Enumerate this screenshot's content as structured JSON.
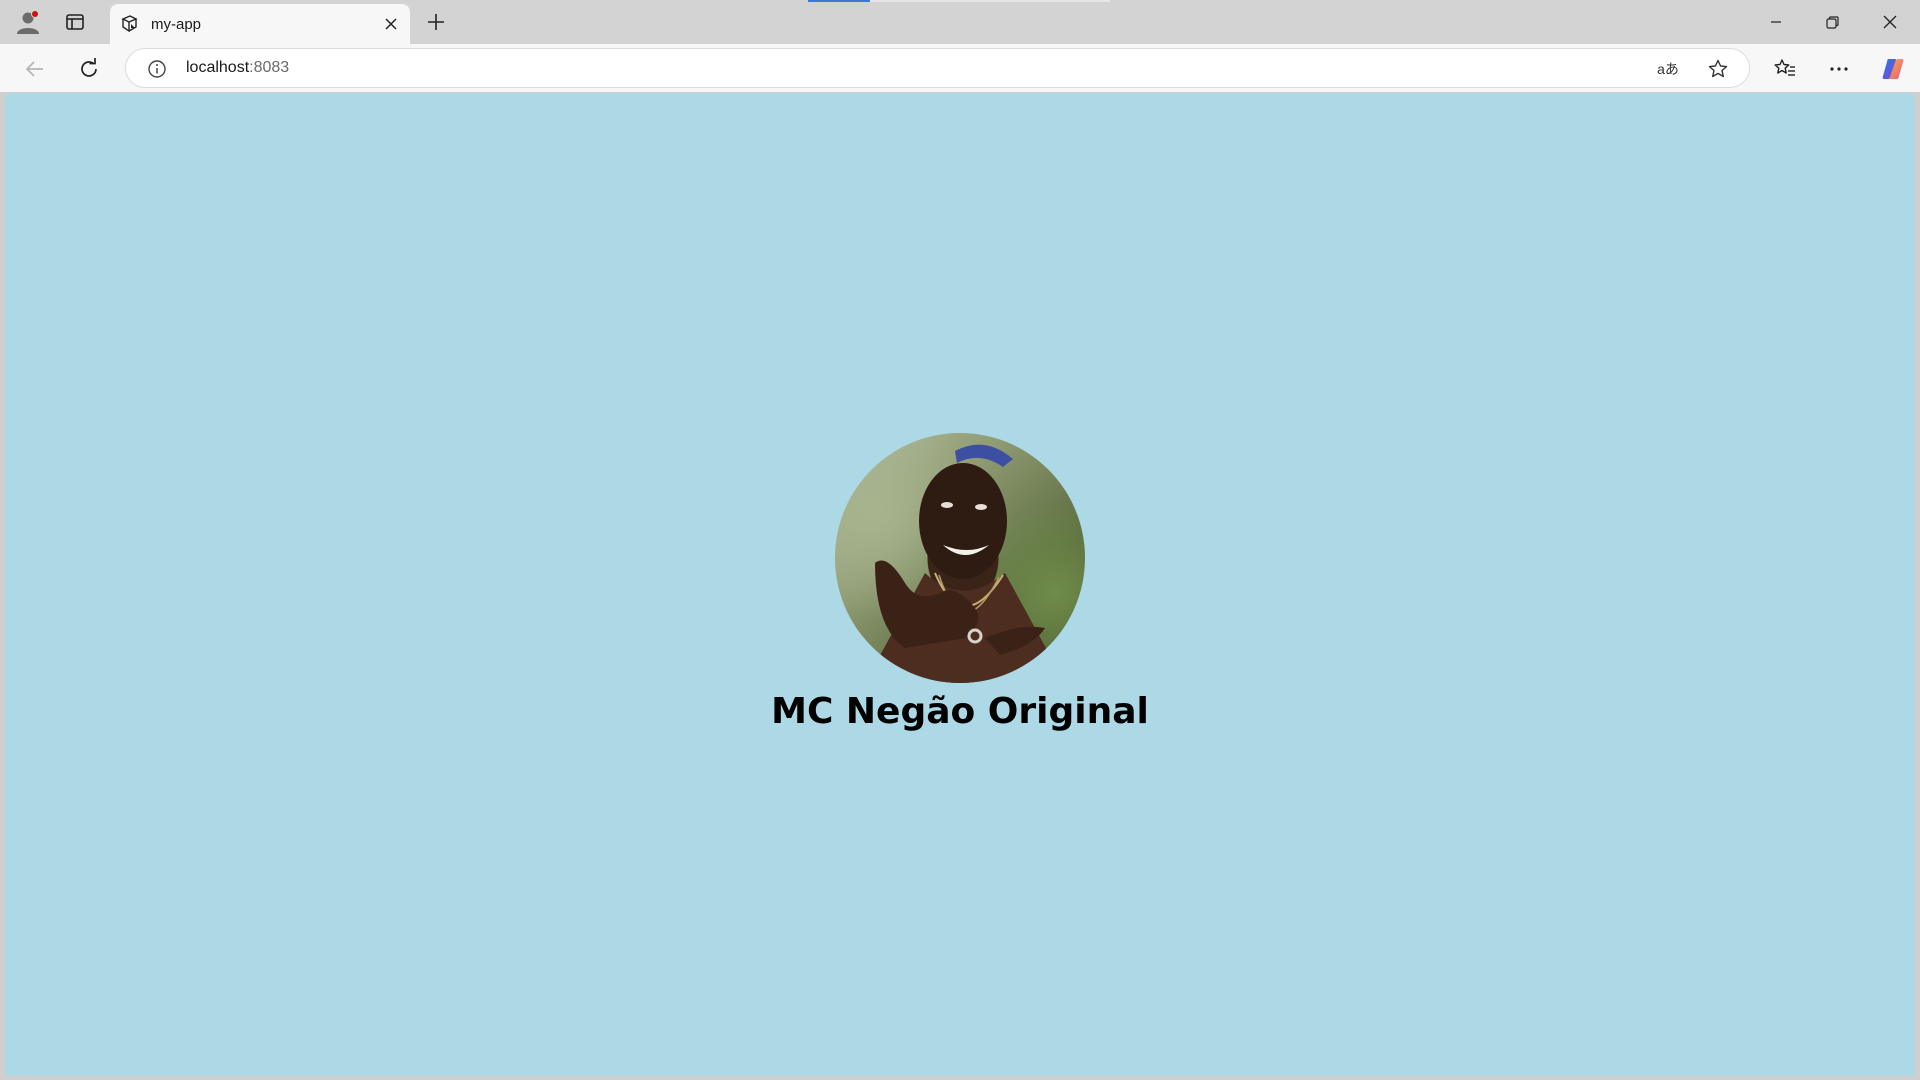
{
  "browser": {
    "tab": {
      "title": "my-app"
    },
    "address": {
      "host": "localhost",
      "port": ":8083"
    },
    "icons": {
      "profile": "profile-icon",
      "sidebar": "sidebar-toggle-icon",
      "favicon": "app-favicon-icon",
      "tab_close": "close-icon",
      "new_tab": "plus-icon",
      "minimize": "minimize-icon",
      "restore": "restore-icon",
      "close_window": "close-icon",
      "back": "back-arrow-icon",
      "reload": "reload-icon",
      "info": "info-icon",
      "translate": "translate-icon",
      "favorite": "star-icon",
      "favorites": "favorites-icon",
      "more": "more-icon",
      "copilot": "copilot-icon"
    },
    "translate_glyph": "aあ"
  },
  "page": {
    "background": "#add8e6",
    "profile": {
      "name": "MC Negão Original",
      "avatar": "profile-photo"
    }
  }
}
